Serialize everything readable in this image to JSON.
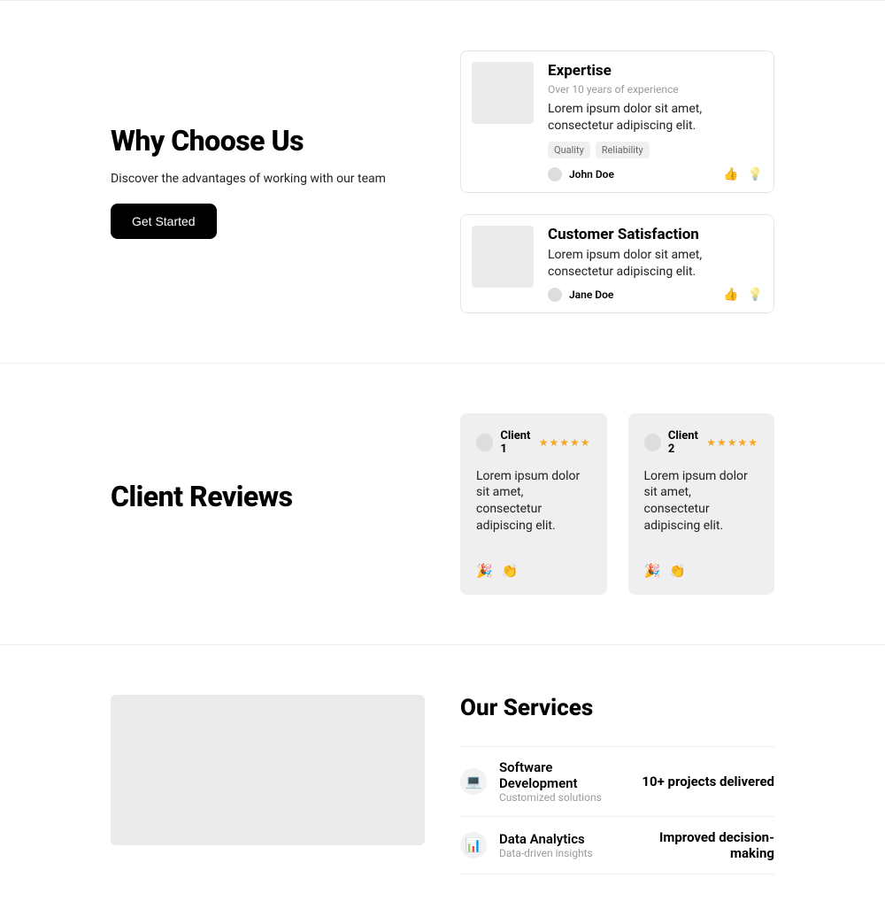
{
  "whyChooseUs": {
    "title": "Why Choose Us",
    "subtitle": "Discover the advantages of working with our team",
    "cta": "Get Started",
    "cards": [
      {
        "title": "Expertise",
        "caption": "Over 10 years of experience",
        "desc": "Lorem ipsum dolor sit amet, consectetur adipiscing elit.",
        "tags": [
          "Quality",
          "Reliability"
        ],
        "author": "John Doe",
        "reactions": [
          "👍",
          "💡"
        ]
      },
      {
        "title": "Customer Satisfaction",
        "caption": "",
        "desc": "Lorem ipsum dolor sit amet, consectetur adipiscing elit.",
        "tags": [],
        "author": "Jane Doe",
        "reactions": [
          "👍",
          "💡"
        ]
      }
    ]
  },
  "reviews": {
    "title": "Client Reviews",
    "items": [
      {
        "name": "Client 1",
        "stars": "★★★★★",
        "text": "Lorem ipsum dolor sit amet, consectetur adipiscing elit.",
        "emoji": [
          "🎉",
          "👏"
        ]
      },
      {
        "name": "Client 2",
        "stars": "★★★★★",
        "text": "Lorem ipsum dolor sit amet, consectetur adipiscing elit.",
        "emoji": [
          "🎉",
          "👏"
        ]
      }
    ]
  },
  "services": {
    "title": "Our Services",
    "items": [
      {
        "icon": "💻",
        "name": "Software Development",
        "sub": "Customized solutions",
        "metric": "10+ projects delivered"
      },
      {
        "icon": "📊",
        "name": "Data Analytics",
        "sub": "Data-driven insights",
        "metric": "Improved decision-making"
      }
    ]
  }
}
